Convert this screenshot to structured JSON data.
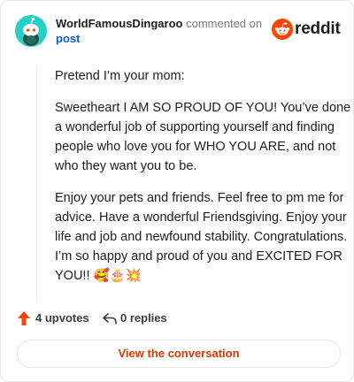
{
  "header": {
    "author": "WorldFamousDingaroo",
    "action_text": "commented on",
    "post_link": "post",
    "brand": "reddit"
  },
  "comment": {
    "paragraphs": [
      "Pretend I’m your mom:",
      "Sweetheart I AM SO PROUD OF YOU! You’ve done a wonderful job of supporting yourself and finding people who love you for WHO YOU ARE, and not who they want you to be.",
      "Enjoy your pets and friends. Feel free to pm me for advice. Have a wonderful Friendsgiving. Enjoy your life and job and newfound stability. Congratulations. I’m so happy and proud of you and EXCITED FOR YOU!! 🥰🎂💥"
    ]
  },
  "stats": {
    "upvotes": "4 upvotes",
    "replies": "0 replies"
  },
  "cta": {
    "label": "View the conversation"
  },
  "colors": {
    "brand_orange": "#ff4500",
    "link_blue": "#0a5de0",
    "cta_text": "#d93a00",
    "avatar_bg": "#24d1c4"
  },
  "icons": [
    "avatar-snoo-icon",
    "reddit-logo-icon",
    "upvote-arrow-icon",
    "reply-icon"
  ]
}
